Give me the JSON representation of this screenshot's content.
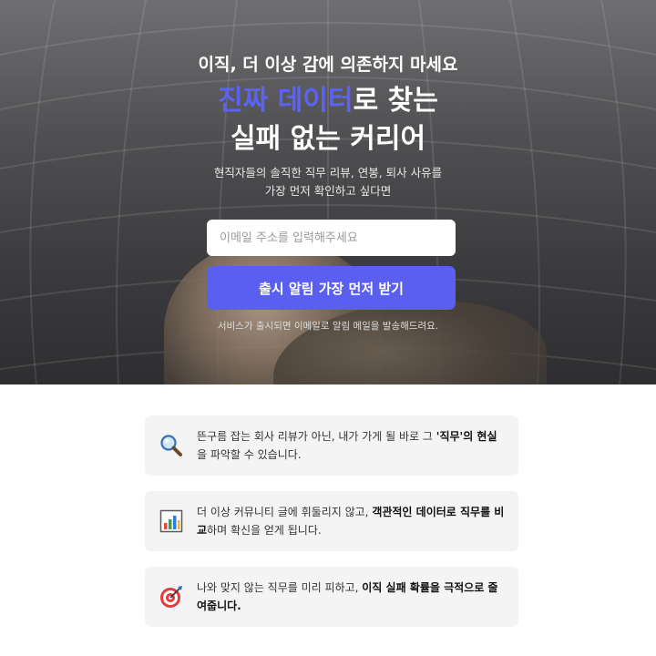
{
  "hero": {
    "eyebrow": "이직, 더 이상 감에 의존하지 마세요",
    "headline_accent": "진짜 데이터",
    "headline_rest": "로 찾는",
    "headline_line2": "실패 없는 커리어",
    "sub_line1": "현직자들의 솔직한 직무 리뷰, 연봉, 퇴사 사유를",
    "sub_line2": "가장 먼저 확인하고 싶다면",
    "email_placeholder": "이메일 주소를 입력해주세요",
    "email_value": "",
    "cta_label": "출시 알림 가장 먼저 받기",
    "note": "서비스가 출시되면 이메일로 알림 메일을 발송해드려요."
  },
  "features": [
    {
      "icon": "magnifier-icon",
      "text_before": "뜬구름 잡는 회사 리뷰가 아닌, 내가 가게 될 바로 그 ",
      "text_bold": "'직무'의 현실",
      "text_after": "을 파악할 수 있습니다."
    },
    {
      "icon": "bar-chart-icon",
      "text_before": "더 이상 커뮤니티 글에 휘둘리지 않고, ",
      "text_bold": "객관적인 데이터로 직무를 비교",
      "text_after": "하며 확신을 얻게 됩니다."
    },
    {
      "icon": "target-icon",
      "text_before": "나와 맞지 않는 직무를 미리 피하고, ",
      "text_bold": "이직 실패 확률을 극적으로 줄여줍니다.",
      "text_after": ""
    }
  ],
  "colors": {
    "accent": "#5a5ff0",
    "headline_accent": "#5b63f5",
    "card_bg": "#f4f4f5"
  }
}
